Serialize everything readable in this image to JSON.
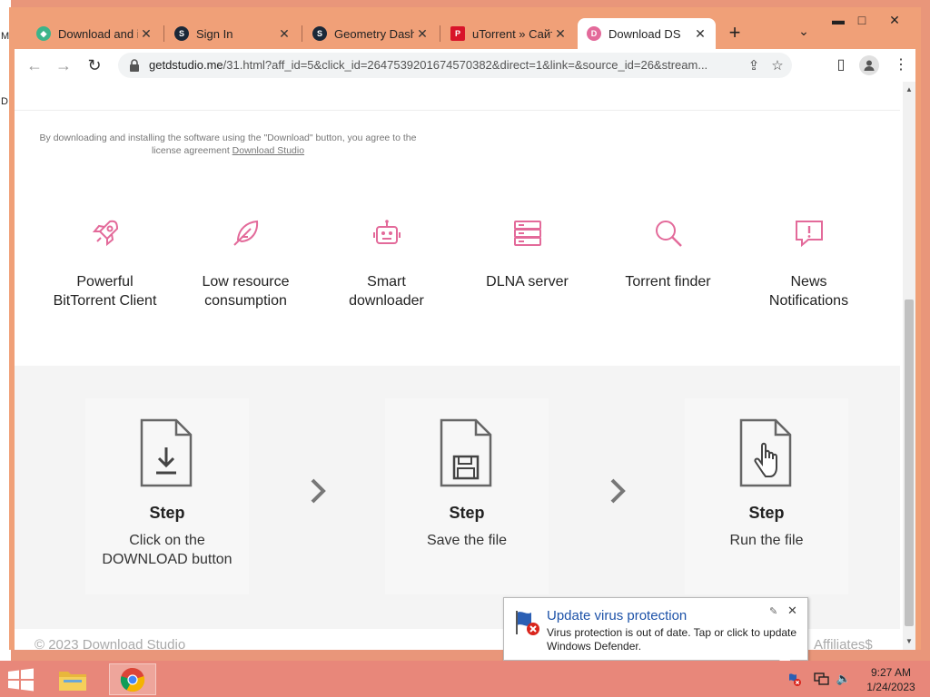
{
  "window": {
    "controls": {
      "minimize": "▬",
      "maximize": "□",
      "close": "✕"
    },
    "accent_color": "#f0a078"
  },
  "tabs": [
    {
      "title": "Download and in",
      "icon": "leaf-gem-icon",
      "active": false
    },
    {
      "title": "Sign In",
      "icon": "steam-icon",
      "active": false
    },
    {
      "title": "Geometry Dash",
      "icon": "steam-icon",
      "active": false
    },
    {
      "title": "uTorrent » Сайт",
      "icon": "pm-icon",
      "active": false
    },
    {
      "title": "Download DS",
      "icon": "download-studio-icon",
      "active": true
    }
  ],
  "toolbar": {
    "back": "←",
    "forward": "→",
    "reload": "↻",
    "url_host": "getdstudio.me",
    "url_path": "/31.html?aff_id=5&click_id=2647539201674570382&direct=1&link=&source_id=26&stream..."
  },
  "page": {
    "license_text": "By downloading and installing the software using the \"Download\" button, you agree to the license agreement",
    "license_link": "Download Studio",
    "features": [
      {
        "label_1": "Powerful",
        "label_2": "BitTorrent Client",
        "icon": "rocket-icon"
      },
      {
        "label_1": "Low resource",
        "label_2": "consumption",
        "icon": "feather-icon"
      },
      {
        "label_1": "Smart",
        "label_2": "downloader",
        "icon": "robot-icon"
      },
      {
        "label_1": "DLNA server",
        "label_2": "",
        "icon": "server-icon"
      },
      {
        "label_1": "Torrent finder",
        "label_2": "",
        "icon": "search-icon"
      },
      {
        "label_1": "News",
        "label_2": "Notifications",
        "icon": "alert-message-icon"
      }
    ],
    "steps": [
      {
        "title": "Step",
        "desc_1": "Click on the",
        "desc_2": "DOWNLOAD button",
        "icon": "file-download-icon"
      },
      {
        "title": "Step",
        "desc_1": "Save the file",
        "desc_2": "",
        "icon": "file-save-icon"
      },
      {
        "title": "Step",
        "desc_1": "Run the file",
        "desc_2": "",
        "icon": "file-click-icon"
      }
    ],
    "footer_copyright": "© 2023 Download Studio",
    "footer_affiliates": "Affiliates$",
    "accent_color": "#e36a9a"
  },
  "notification": {
    "title": "Update virus protection",
    "body": "Virus protection is out of date. Tap or click to update Windows Defender.",
    "icon": "defender-flag-icon"
  },
  "taskbar": {
    "time": "9:27 AM",
    "date": "1/24/2023",
    "apps": [
      "file-explorer-icon",
      "chrome-icon"
    ]
  }
}
